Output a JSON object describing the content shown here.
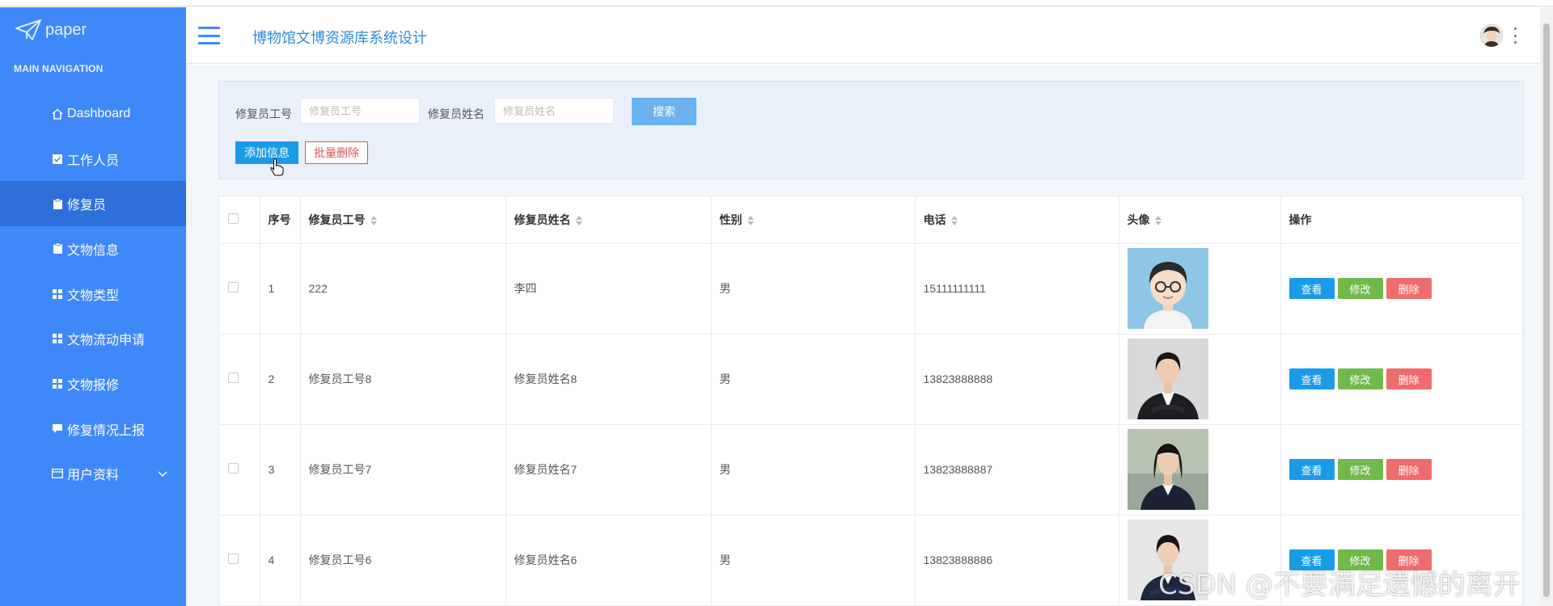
{
  "app": {
    "logo_text": "paper",
    "title": "博物馆文博资源库系统设计"
  },
  "sidebar": {
    "heading": "MAIN NAVIGATION",
    "items": [
      {
        "label": "Dashboard",
        "icon": "home-icon"
      },
      {
        "label": "工作人员",
        "icon": "check-square-icon"
      },
      {
        "label": "修复员",
        "icon": "clipboard-icon",
        "active": true
      },
      {
        "label": "文物信息",
        "icon": "clipboard-icon"
      },
      {
        "label": "文物类型",
        "icon": "grid-icon"
      },
      {
        "label": "文物流动申请",
        "icon": "grid-icon"
      },
      {
        "label": "文物报修",
        "icon": "grid-icon"
      },
      {
        "label": "修复情况上报",
        "icon": "comment-icon"
      },
      {
        "label": "用户资料",
        "icon": "id-card-icon",
        "has_submenu": true
      }
    ]
  },
  "search": {
    "id_label": "修复员工号",
    "id_placeholder": "修复员工号",
    "name_label": "修复员姓名",
    "name_placeholder": "修复员姓名",
    "search_button": "搜索",
    "add_button": "添加信息",
    "batch_delete_button": "批量删除"
  },
  "table": {
    "headers": [
      "序号",
      "修复员工号",
      "修复员姓名",
      "性别",
      "电话",
      "头像",
      "操作"
    ],
    "rows": [
      {
        "no": "1",
        "id": "222",
        "name": "李四",
        "gender": "男",
        "phone": "15111111111"
      },
      {
        "no": "2",
        "id": "修复员工号8",
        "name": "修复员姓名8",
        "gender": "男",
        "phone": "13823888888"
      },
      {
        "no": "3",
        "id": "修复员工号7",
        "name": "修复员姓名7",
        "gender": "男",
        "phone": "13823888887"
      },
      {
        "no": "4",
        "id": "修复员工号6",
        "name": "修复员姓名6",
        "gender": "男",
        "phone": "13823888886"
      }
    ],
    "actions": {
      "view": "查看",
      "edit": "修改",
      "delete": "删除"
    }
  },
  "watermark": "CSDN @不要满足遗憾的离开",
  "colors": {
    "sidebar": "#3f88fa",
    "sidebar_active": "#2f6fda",
    "primary": "#1a9be8",
    "success": "#72b94b",
    "danger": "#f06b6b"
  }
}
